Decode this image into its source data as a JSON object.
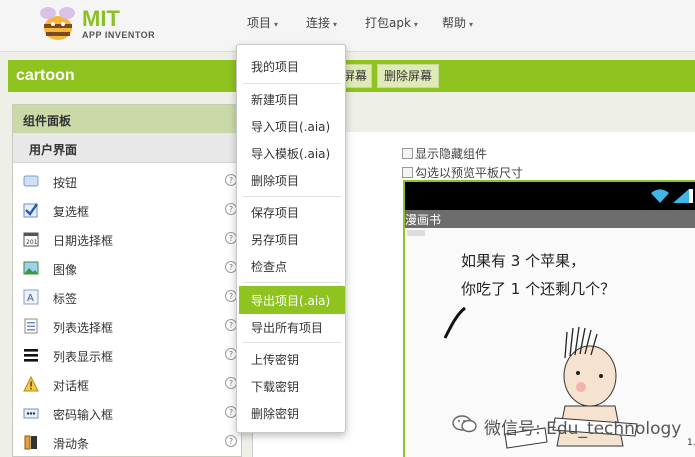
{
  "app": {
    "logo_title": "MIT",
    "logo_subtitle": "APP INVENTOR"
  },
  "topmenu": [
    {
      "label": "项目"
    },
    {
      "label": "连接"
    },
    {
      "label": "打包apk"
    },
    {
      "label": "帮助"
    }
  ],
  "project": {
    "name": "cartoon",
    "screen_button_partial": "屏幕",
    "remove_screen_button": "删除屏幕"
  },
  "palette": {
    "title": "组件面板",
    "category": "用户界面",
    "components": [
      {
        "label": "按钮",
        "icon": "button-icon"
      },
      {
        "label": "复选框",
        "icon": "checkbox-icon"
      },
      {
        "label": "日期选择框",
        "icon": "calendar-icon"
      },
      {
        "label": "图像",
        "icon": "image-icon"
      },
      {
        "label": "标签",
        "icon": "label-icon"
      },
      {
        "label": "列表选择框",
        "icon": "list-picker-icon"
      },
      {
        "label": "列表显示框",
        "icon": "list-view-icon"
      },
      {
        "label": "对话框",
        "icon": "warning-icon"
      },
      {
        "label": "密码输入框",
        "icon": "password-icon"
      },
      {
        "label": "滑动条",
        "icon": "slider-icon"
      }
    ],
    "help_glyph": "?"
  },
  "viewer": {
    "show_hidden": "显示隐藏组件",
    "tablet_preview": "勾选以预览平板尺寸",
    "screen_title": "漫画书",
    "comic_line1": "如果有 3 个苹果，",
    "comic_line2": "你吃了 1 个还剩几个？",
    "corner_text": "1."
  },
  "dropdown": {
    "items": [
      {
        "label": "我的项目"
      },
      {
        "label": "新建项目"
      },
      {
        "label": "导入项目(.aia)"
      },
      {
        "label": "导入模板(.aia)"
      },
      {
        "label": "删除项目"
      },
      {
        "label": "保存项目"
      },
      {
        "label": "另存项目"
      },
      {
        "label": "检查点"
      },
      {
        "label": "导出项目(.aia)"
      },
      {
        "label": "导出所有项目"
      },
      {
        "label": "上传密钥"
      },
      {
        "label": "下载密钥"
      },
      {
        "label": "删除密钥"
      }
    ],
    "active_item": "导出项目(.aia)"
  },
  "watermark": {
    "text": "微信号: Edu_technology"
  },
  "colors": {
    "accent": "#8fc31f",
    "panel_header": "#cbd9a8",
    "logo_green": "#8cbf26"
  }
}
